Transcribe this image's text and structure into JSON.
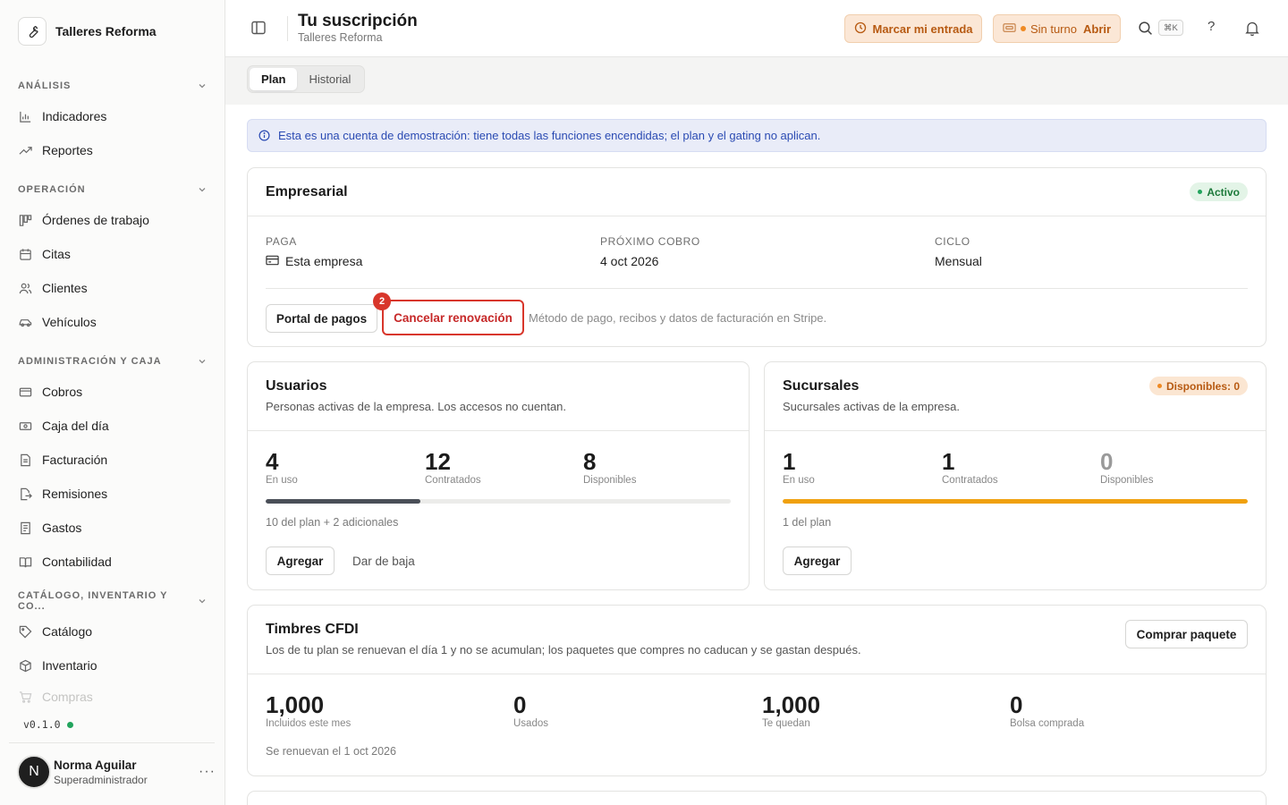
{
  "sidebar": {
    "brand": "Talleres Reforma",
    "sections": [
      {
        "title": "ANÁLISIS",
        "items": [
          {
            "label": "Indicadores",
            "icon": "bar-chart-icon"
          },
          {
            "label": "Reportes",
            "icon": "trending-up-icon"
          }
        ]
      },
      {
        "title": "OPERACIÓN",
        "items": [
          {
            "label": "Órdenes de trabajo",
            "icon": "kanban-icon"
          },
          {
            "label": "Citas",
            "icon": "calendar-icon"
          },
          {
            "label": "Clientes",
            "icon": "users-icon"
          },
          {
            "label": "Vehículos",
            "icon": "car-icon"
          }
        ]
      },
      {
        "title": "ADMINISTRACIÓN Y CAJA",
        "items": [
          {
            "label": "Cobros",
            "icon": "credit-card-icon"
          },
          {
            "label": "Caja del día",
            "icon": "cash-icon"
          },
          {
            "label": "Facturación",
            "icon": "file-text-icon"
          },
          {
            "label": "Remisiones",
            "icon": "file-export-icon"
          },
          {
            "label": "Gastos",
            "icon": "receipt-icon"
          },
          {
            "label": "Contabilidad",
            "icon": "book-icon"
          }
        ]
      },
      {
        "title": "CATÁLOGO, INVENTARIO Y CO...",
        "items": [
          {
            "label": "Catálogo",
            "icon": "tag-icon"
          },
          {
            "label": "Inventario",
            "icon": "box-icon"
          },
          {
            "label": "Compras",
            "icon": "cart-icon"
          }
        ]
      }
    ],
    "version": "v0.1.0",
    "user": {
      "initial": "N",
      "name": "Norma Aguilar",
      "role": "Superadministrador"
    }
  },
  "header": {
    "title": "Tu suscripción",
    "subtitle": "Talleres Reforma",
    "clock_in": "Marcar mi entrada",
    "shift_status": "Sin turno",
    "shift_action": "Abrir",
    "shortcut": "⌘K",
    "help": "?"
  },
  "tabs": [
    "Plan",
    "Historial"
  ],
  "info_banner": "Esta es una cuenta de demostración: tiene todas las funciones encendidas; el plan y el gating no aplican.",
  "plan": {
    "name": "Empresarial",
    "status": "Activo",
    "fields": [
      {
        "label": "PAGA",
        "value": "Esta empresa"
      },
      {
        "label": "PRÓXIMO COBRO",
        "value": "4 oct 2026"
      },
      {
        "label": "CICLO",
        "value": "Mensual"
      }
    ],
    "portal_button": "Portal de pagos",
    "cancel_button": "Cancelar renovación",
    "step_badge": "2",
    "note": "Método de pago, recibos y datos de facturación en Stripe."
  },
  "usuarios": {
    "title": "Usuarios",
    "subtitle": "Personas activas de la empresa. Los accesos no cuentan.",
    "stats": [
      {
        "value": "4",
        "label": "En uso"
      },
      {
        "value": "12",
        "label": "Contratados"
      },
      {
        "value": "8",
        "label": "Disponibles"
      }
    ],
    "progress": 0.333,
    "bar_color": "#4a4f58",
    "note": "10 del plan + 2 adicionales",
    "add_button": "Agregar",
    "remove_button": "Dar de baja"
  },
  "sucursales": {
    "title": "Sucursales",
    "subtitle": "Sucursales activas de la empresa.",
    "badge": "Disponibles: 0",
    "stats": [
      {
        "value": "1",
        "label": "En uso"
      },
      {
        "value": "1",
        "label": "Contratados"
      },
      {
        "value": "0",
        "label": "Disponibles"
      }
    ],
    "progress": 1.0,
    "bar_color": "#f0a10f",
    "note": "1 del plan",
    "add_button": "Agregar"
  },
  "timbres": {
    "title": "Timbres CFDI",
    "subtitle": "Los de tu plan se renuevan el día 1 y no se acumulan; los paquetes que compres no caducan y se gastan después.",
    "buy_button": "Comprar paquete",
    "stats": [
      {
        "value": "1,000",
        "label": "Incluidos este mes"
      },
      {
        "value": "0",
        "label": "Usados"
      },
      {
        "value": "1,000",
        "label": "Te quedan"
      },
      {
        "value": "0",
        "label": "Bolsa comprada"
      }
    ],
    "note": "Se renuevan el 1 oct 2026"
  }
}
